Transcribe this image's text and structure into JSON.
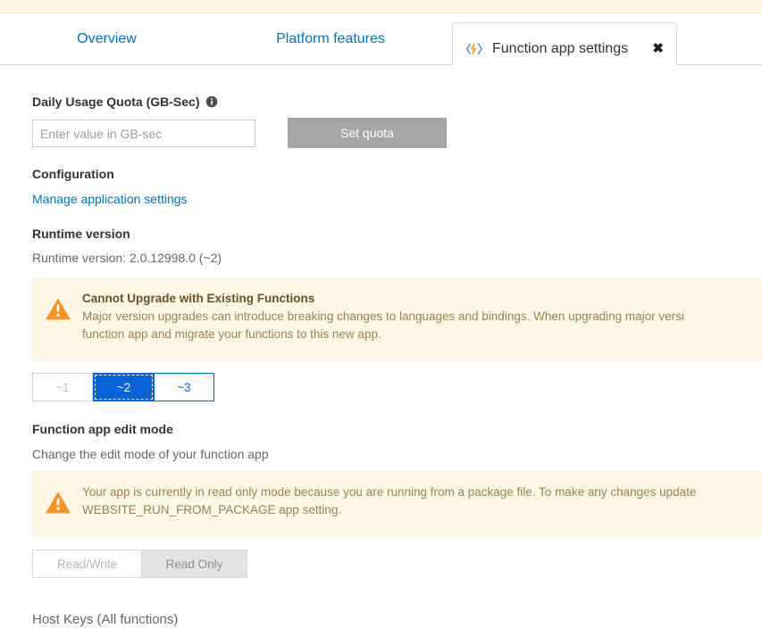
{
  "tabs": {
    "overview_label": "Overview",
    "platform_label": "Platform features",
    "active_label": "Function app settings",
    "active_icon": "azure-functions-lightning-icon",
    "close_label": "✖"
  },
  "quota": {
    "heading": "Daily Usage Quota (GB-Sec)",
    "info_icon": "info-icon",
    "placeholder": "Enter value in GB-sec",
    "value": "",
    "button_label": "Set quota"
  },
  "configuration": {
    "heading": "Configuration",
    "link_label": "Manage application settings"
  },
  "runtime": {
    "heading": "Runtime version",
    "value_label": "Runtime version: 2.0.12998.0 (~2)",
    "warning": {
      "icon": "warning-triangle-icon",
      "title": "Cannot Upgrade with Existing Functions",
      "line1": "Major version upgrades can introduce breaking changes to languages and bindings. When upgrading major versi",
      "line2": "function app and migrate your functions to this new app."
    },
    "versions": [
      {
        "label": "~1",
        "state": "disabled"
      },
      {
        "label": "~2",
        "state": "selected"
      },
      {
        "label": "~3",
        "state": "enabled"
      }
    ]
  },
  "edit_mode": {
    "heading": "Function app edit mode",
    "subtext": "Change the edit mode of your function app",
    "warning": {
      "icon": "warning-triangle-icon",
      "line1": "Your app is currently in read only mode because you are running from a package file. To make any changes update",
      "line2": "WEBSITE_RUN_FROM_PACKAGE app setting."
    },
    "options": [
      {
        "label": "Read/Write",
        "state": "disabled"
      },
      {
        "label": "Read Only",
        "state": "selected-disabled"
      }
    ]
  },
  "host_keys": {
    "heading": "Host Keys (All functions)"
  },
  "colors": {
    "link": "#0072c6",
    "accent_blue": "#0a63d6",
    "warning_bg": "#fdf7e6",
    "warning_icon": "#f79321",
    "warning_text": "#9a8157",
    "disabled_button": "#a6a6a6"
  }
}
